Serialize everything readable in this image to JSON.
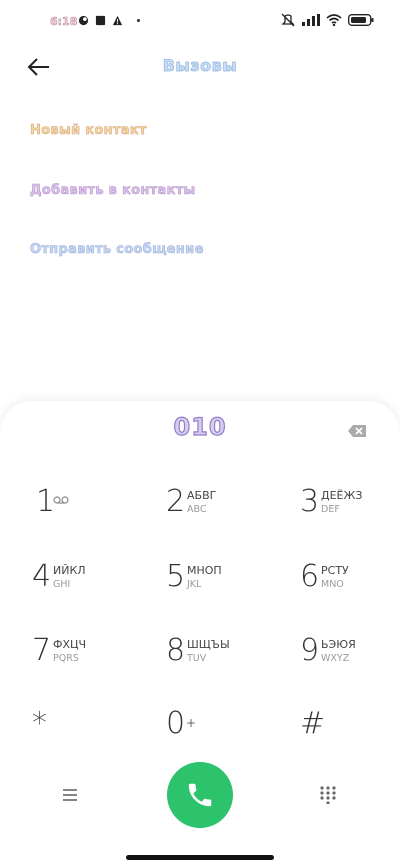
{
  "status_bar": {
    "time": "6:18",
    "icons": [
      "app-icon",
      "square-icon",
      "warning-icon",
      "dot-icon",
      "mute-icon",
      "signal-icon",
      "wifi-icon",
      "battery-icon"
    ]
  },
  "header": {
    "title": "Вызовы",
    "back_icon": "arrow-left-icon"
  },
  "menu": {
    "items": [
      {
        "label": "Новый контакт"
      },
      {
        "label": "Добавить в контакты"
      },
      {
        "label": "Отправить сообщение"
      }
    ]
  },
  "dialer": {
    "number": "010",
    "keys": [
      {
        "digit": "1",
        "letters": "",
        "latin": ""
      },
      {
        "digit": "2",
        "letters": "АБВГ",
        "latin": "ABC"
      },
      {
        "digit": "3",
        "letters": "ДЕЁЖЗ",
        "latin": "DEF"
      },
      {
        "digit": "4",
        "letters": "ИЙКЛ",
        "latin": "GHI"
      },
      {
        "digit": "5",
        "letters": "МНОП",
        "latin": "JKL"
      },
      {
        "digit": "6",
        "letters": "РСТУ",
        "latin": "MNO"
      },
      {
        "digit": "7",
        "letters": "ФХЦЧ",
        "latin": "PQRS"
      },
      {
        "digit": "8",
        "letters": "ШЩЪЫ",
        "latin": "TUV"
      },
      {
        "digit": "9",
        "letters": "ЬЭЮЯ",
        "latin": "WXYZ"
      },
      {
        "digit": "*",
        "letters": "",
        "latin": ""
      },
      {
        "digit": "0",
        "letters": "",
        "latin": "",
        "extra": "+"
      },
      {
        "digit": "#",
        "letters": "",
        "latin": ""
      }
    ]
  },
  "colors": {
    "call_button": "#2dc26c",
    "title_fill": "#c9def7",
    "number_fill": "#d9ccf3"
  }
}
